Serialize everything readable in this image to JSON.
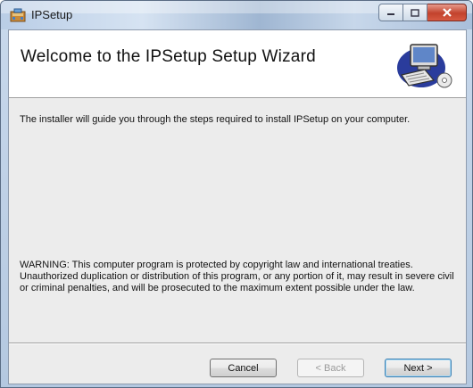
{
  "window": {
    "title": "IPSetup",
    "app_icon": "installer-icon"
  },
  "caption_buttons": {
    "minimize": "minimize-icon",
    "maximize": "maximize-icon",
    "close": "close-icon"
  },
  "banner": {
    "title": "Welcome to the IPSetup Setup Wizard",
    "image": "computer-setup-icon"
  },
  "body": {
    "intro": "The installer will guide you through the steps required to install IPSetup on your computer.",
    "warning": "WARNING: This computer program is protected by copyright law and international treaties. Unauthorized duplication or distribution of this program, or any portion of it, may result in severe civil or criminal penalties, and will be prosecuted to the maximum extent possible under the law."
  },
  "buttons": {
    "cancel": "Cancel",
    "back": "< Back",
    "next": "Next >"
  }
}
